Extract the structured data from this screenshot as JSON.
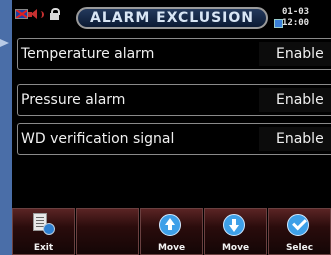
{
  "header": {
    "title": "ALARM EXCLUSION",
    "date": "01-03",
    "time": "12:00"
  },
  "alarms": [
    {
      "label": "Temperature alarm",
      "value": "Enable"
    },
    {
      "label": "Pressure alarm",
      "value": "Enable"
    },
    {
      "label": "WD verification signal",
      "value": "Enable"
    }
  ],
  "buttons": {
    "exit": "Exit",
    "move_up": "Move",
    "move_down": "Move",
    "select": "Selec"
  },
  "colors": {
    "accent": "#3ea0e8",
    "button_bg": "#2a0c0c",
    "title_bg": "#0b1a33"
  }
}
